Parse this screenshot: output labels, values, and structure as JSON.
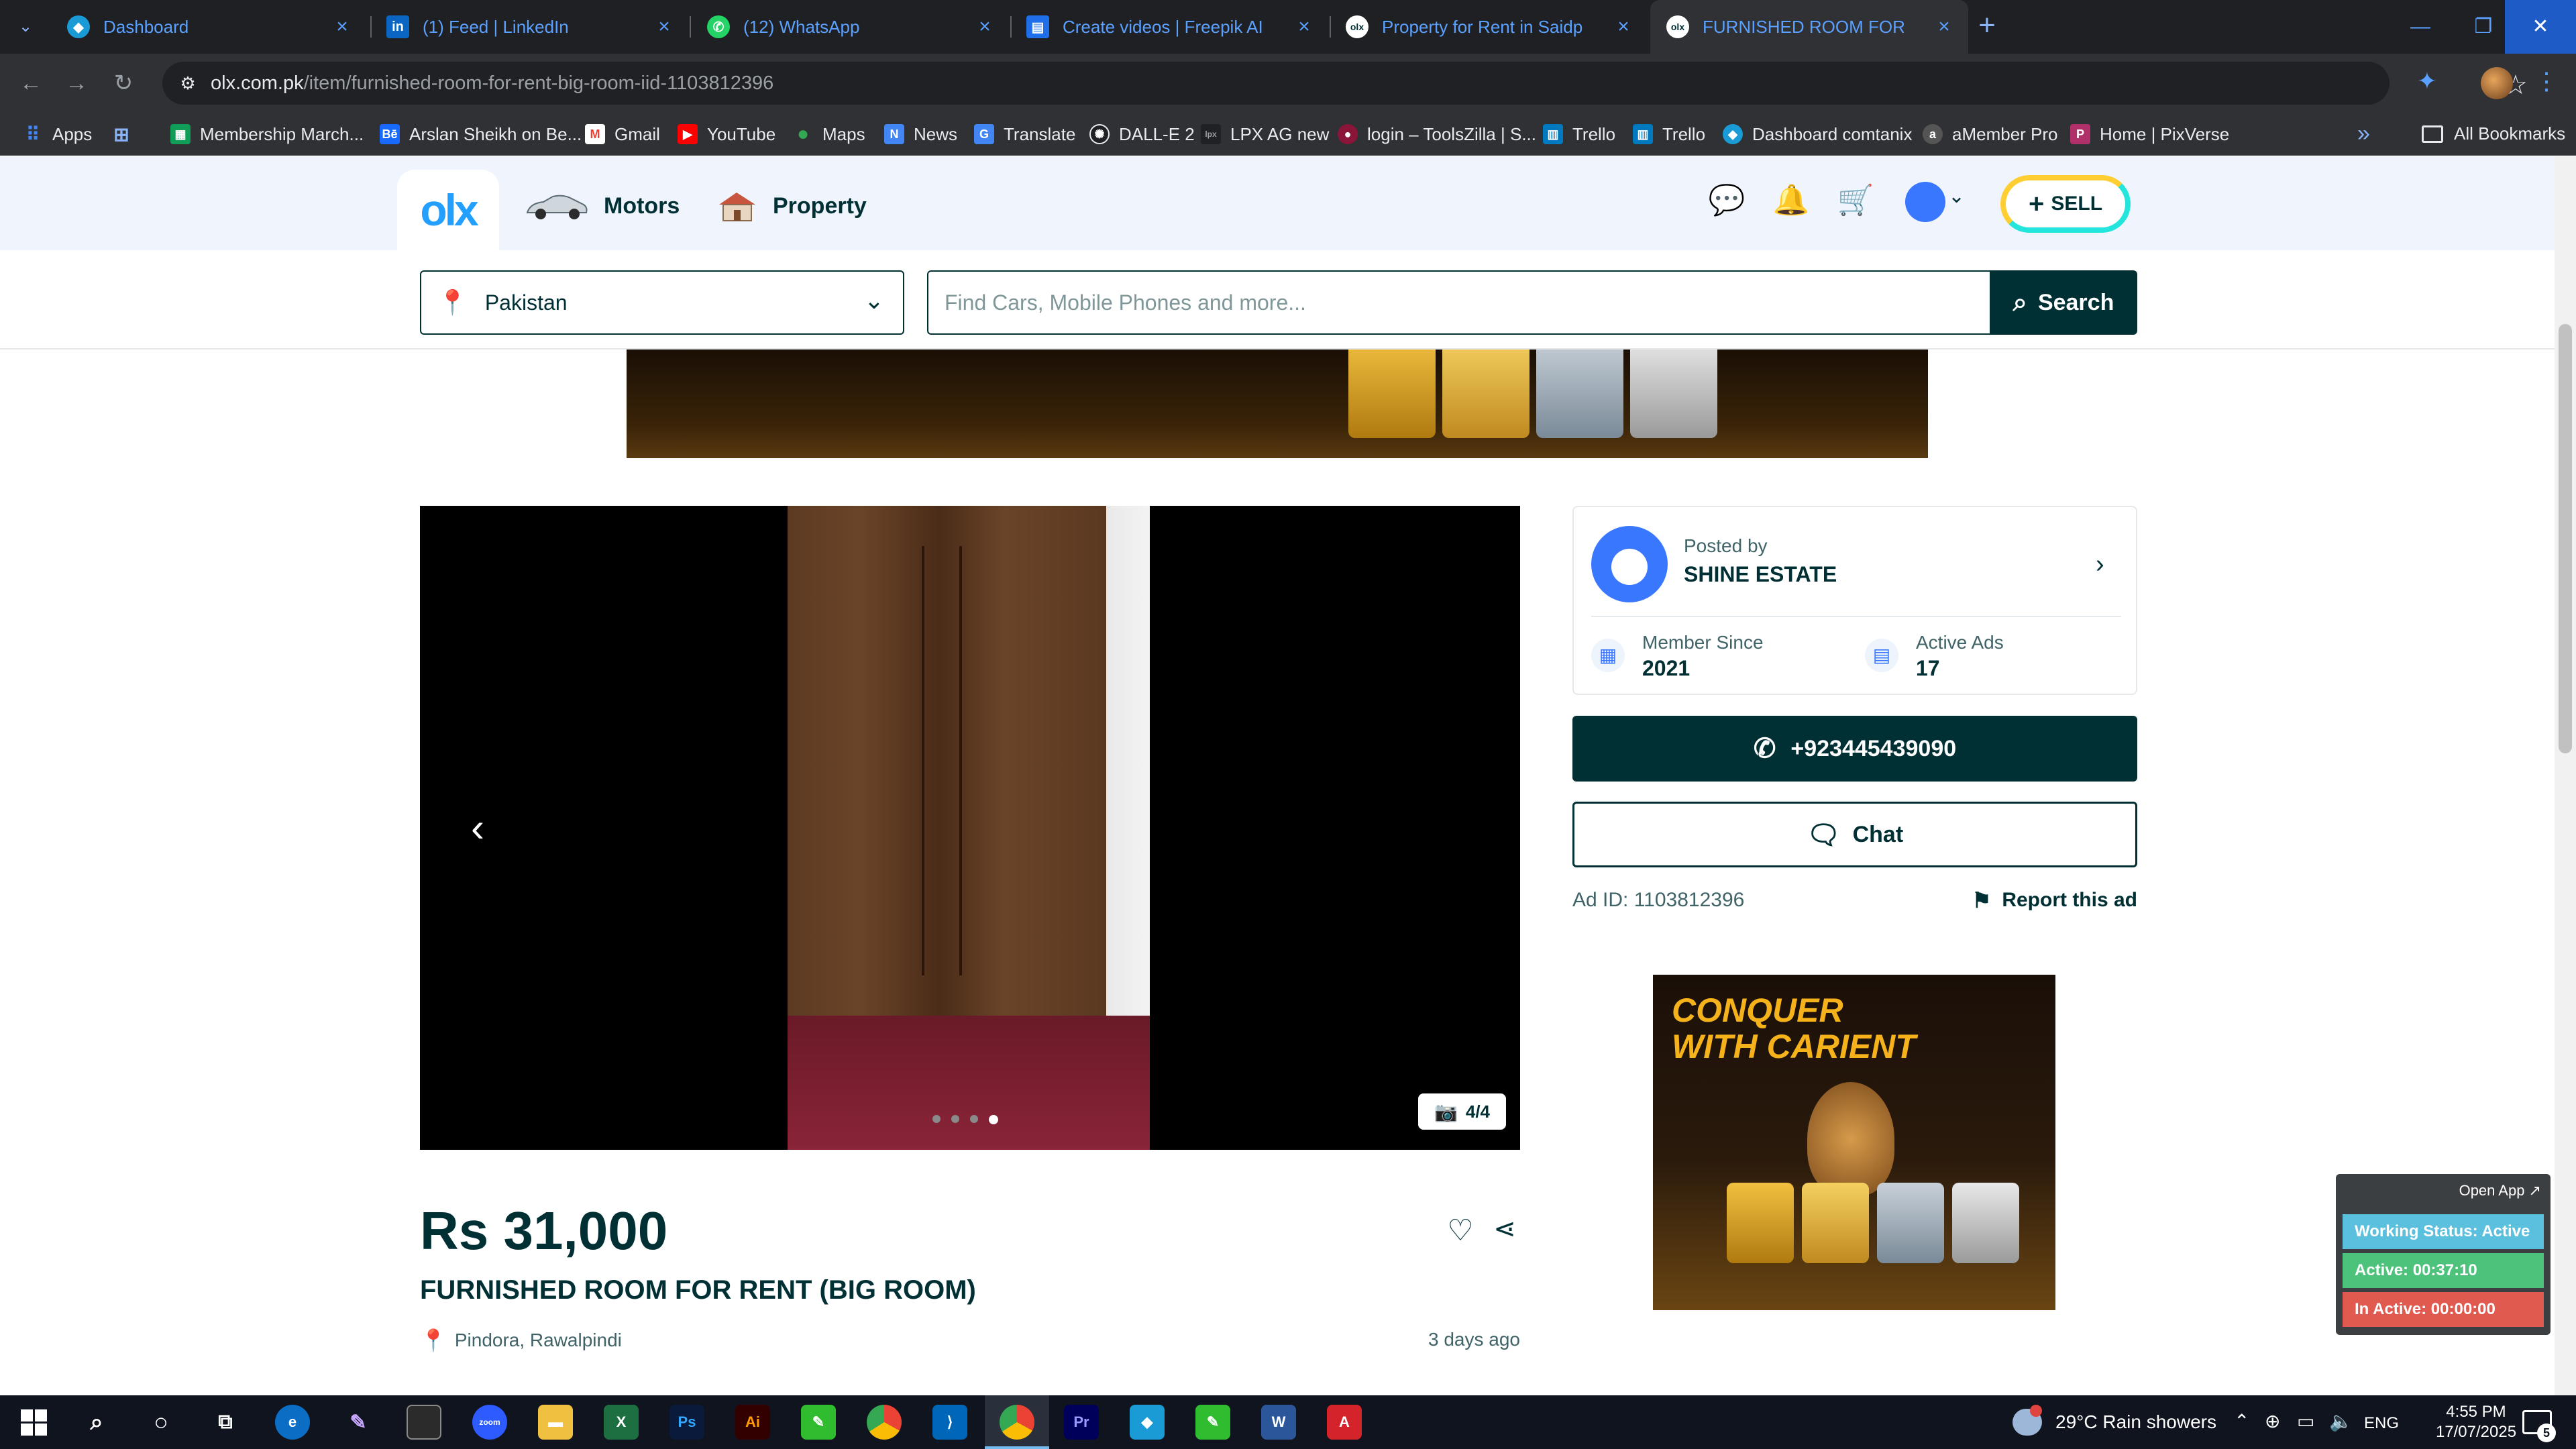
{
  "browser": {
    "tabs": [
      {
        "title": "Dashboard",
        "icon": "dashboard-favicon-icon",
        "color": "#1b9bd6"
      },
      {
        "title": "(1) Feed | LinkedIn",
        "icon": "linkedin-icon",
        "color": "#0a66c2"
      },
      {
        "title": "(12) WhatsApp",
        "icon": "whatsapp-icon",
        "color": "#25d366"
      },
      {
        "title": "Create videos | Freepik AI",
        "icon": "freepik-icon",
        "color": "#1f6feb"
      },
      {
        "title": "Property for Rent in Saidpur Road",
        "icon": "olx-favicon-icon",
        "color": "#ffffff"
      },
      {
        "title": "FURNISHED ROOM FOR RENT (BIG ROOM)",
        "icon": "olx-favicon-icon",
        "color": "#ffffff"
      }
    ],
    "url": {
      "host": "olx.com.pk",
      "path": "/item/furnished-room-for-rent-big-room-iid-1103812396"
    },
    "bookmarks": [
      {
        "label": "Apps",
        "icon": "apps-grid-icon",
        "color": "#4285f4"
      },
      {
        "label": "",
        "icon": "grid-icon",
        "color": "#8ab4f8"
      },
      {
        "label": "Membership March...",
        "icon": "sheets-icon",
        "color": "#0f9d58"
      },
      {
        "label": "Arslan Sheikh on Be...",
        "icon": "behance-icon",
        "color": "#1769ff"
      },
      {
        "label": "Gmail",
        "icon": "gmail-icon",
        "color": "#ea4335"
      },
      {
        "label": "YouTube",
        "icon": "youtube-icon",
        "color": "#ff0000"
      },
      {
        "label": "Maps",
        "icon": "maps-icon",
        "color": "#34a853"
      },
      {
        "label": "News",
        "icon": "news-icon",
        "color": "#4285f4"
      },
      {
        "label": "Translate",
        "icon": "translate-icon",
        "color": "#4285f4"
      },
      {
        "label": "DALL-E 2",
        "icon": "openai-icon",
        "color": "#202124"
      },
      {
        "label": "LPX AG new",
        "icon": "lpx-icon",
        "color": "#202124"
      },
      {
        "label": "login – ToolsZilla | S...",
        "icon": "toolszilla-icon",
        "color": "#8a1538"
      },
      {
        "label": "Trello",
        "icon": "trello-icon",
        "color": "#0079bf"
      },
      {
        "label": "Trello",
        "icon": "trello-icon",
        "color": "#0079bf"
      },
      {
        "label": "Dashboard comtanix",
        "icon": "comtanix-icon",
        "color": "#1b9bd6"
      },
      {
        "label": "aMember Pro",
        "icon": "amember-icon",
        "color": "#555555"
      },
      {
        "label": "Home | PixVerse",
        "icon": "pixverse-icon",
        "color": "#b0306a"
      }
    ],
    "all_bookmarks": "All Bookmarks"
  },
  "olx": {
    "logo": "olx",
    "categories": [
      {
        "label": "Motors",
        "icon": "car-icon"
      },
      {
        "label": "Property",
        "icon": "house-icon"
      }
    ],
    "sell_label": "SELL",
    "location": "Pakistan",
    "search_placeholder": "Find Cars, Mobile Phones and more...",
    "search_label": "Search",
    "gallery": {
      "counter": "4/4",
      "total": 4,
      "current": 4
    },
    "price": "Rs 31,000",
    "title": "FURNISHED ROOM FOR RENT (BIG ROOM)",
    "location_text": "Pindora, Rawalpindi",
    "posted_ago": "3 days ago",
    "seller": {
      "posted_by_label": "Posted by",
      "name": "SHINE ESTATE",
      "member_since_label": "Member Since",
      "member_since": "2021",
      "active_ads_label": "Active Ads",
      "active_ads": "17"
    },
    "phone": "+923445439090",
    "chat_label": "Chat",
    "ad_id": "Ad ID: 1103812396",
    "report_label": "Report this ad",
    "side_ad_text": "CONQUER\nWITH CARIENT"
  },
  "tracker": {
    "open_app": "Open App ↗",
    "working_status": "Working Status: Active",
    "active": "Active: 00:37:10",
    "inactive": "In Active: 00:00:00",
    "colors": {
      "status": "#5bc0de",
      "active": "#4cc27a",
      "inactive": "#e05a4f"
    }
  },
  "taskbar": {
    "weather": "29°C  Rain showers",
    "lang": "ENG",
    "time": "4:55 PM",
    "date": "17/07/2025",
    "notifications": "5"
  }
}
